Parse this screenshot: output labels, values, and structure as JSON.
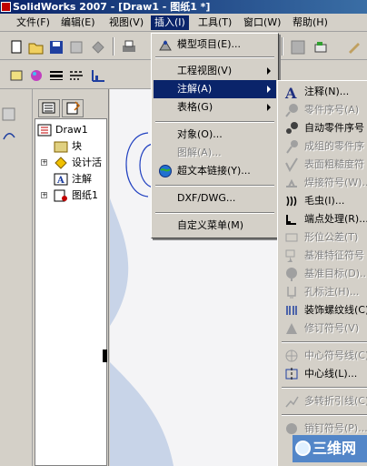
{
  "window": {
    "title": "SolidWorks 2007 - [Draw1 - 图纸1 *]"
  },
  "menubar": {
    "items": [
      {
        "label": "文件(F)"
      },
      {
        "label": "编辑(E)"
      },
      {
        "label": "视图(V)"
      },
      {
        "label": "插入(I)"
      },
      {
        "label": "工具(T)"
      },
      {
        "label": "窗口(W)"
      },
      {
        "label": "帮助(H)"
      }
    ]
  },
  "insert_menu": {
    "items": [
      {
        "label": "模型项目(E)..."
      },
      {
        "label": "工程视图(V)"
      },
      {
        "label": "注解(A)"
      },
      {
        "label": "表格(G)"
      },
      {
        "label": "对象(O)..."
      },
      {
        "label": "图解(A)..."
      },
      {
        "label": "超文本链接(Y)..."
      },
      {
        "label": "DXF/DWG..."
      },
      {
        "label": "自定义菜单(M)"
      }
    ]
  },
  "annotation_submenu": {
    "items": [
      {
        "label": "注释(N)..."
      },
      {
        "label": "零件序号(A)"
      },
      {
        "label": "自动零件序号"
      },
      {
        "label": "成组的零件序"
      },
      {
        "label": "表面粗糙度符"
      },
      {
        "label": "焊接符号(W)..."
      },
      {
        "label": "毛虫(I)..."
      },
      {
        "label": "端点处理(R)..."
      },
      {
        "label": "形位公差(T)"
      },
      {
        "label": "基准特征符号"
      },
      {
        "label": "基准目标(D)..."
      },
      {
        "label": "孔标注(H)..."
      },
      {
        "label": "装饰螺纹线(C)"
      },
      {
        "label": "修订符号(V)"
      },
      {
        "label": "中心符号线(C)"
      },
      {
        "label": "中心线(L)..."
      },
      {
        "label": "多转折引线(C)"
      },
      {
        "label": "销钉符号(P)..."
      }
    ]
  },
  "tree": {
    "root": "Draw1",
    "items": [
      {
        "label": "块"
      },
      {
        "label": "设计活"
      },
      {
        "label": "注解"
      },
      {
        "label": "图纸1"
      }
    ]
  },
  "watermark": {
    "text": "三维网"
  }
}
